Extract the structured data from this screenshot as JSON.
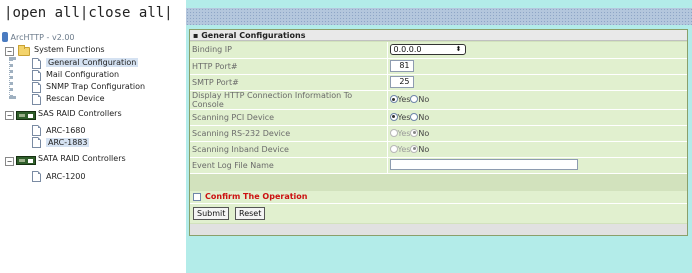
{
  "toolbar": {
    "open_all": "open all",
    "sep": "|",
    "close_all": "close all"
  },
  "tree": {
    "root": "ArcHTTP - v2.00",
    "system_functions": "System Functions",
    "items": [
      "General Configuration",
      "Mail Configuration",
      "SNMP Trap Configuration",
      "Rescan Device"
    ],
    "sas": "SAS RAID Controllers",
    "sas_items": [
      "ARC-1680",
      "ARC-1883"
    ],
    "sata": "SATA RAID Controllers",
    "sata_items": [
      "ARC-1200"
    ]
  },
  "panel": {
    "title": "General Configurations",
    "rows": [
      {
        "label": "Binding IP",
        "value": "0.0.0.0"
      },
      {
        "label": "HTTP Port#",
        "value": "81"
      },
      {
        "label": "SMTP Port#",
        "value": "25"
      },
      {
        "label": "Display HTTP Connection Information To Console",
        "yes": "Yes",
        "no": "No",
        "selected": "Yes"
      },
      {
        "label": "Scanning PCI Device",
        "yes": "Yes",
        "no": "No",
        "selected": "Yes"
      },
      {
        "label": "Scanning RS-232 Device",
        "yes": "Yes",
        "no": "No",
        "selected": "No"
      },
      {
        "label": "Scanning Inband Device",
        "yes": "Yes",
        "no": "No",
        "selected": "No"
      },
      {
        "label": "Event Log File Name",
        "value": ""
      }
    ],
    "confirm": "Confirm The Operation",
    "submit": "Submit",
    "reset": "Reset"
  },
  "colors": {
    "accent_bg": "#b3ece9",
    "panel": "#d2e2bd",
    "confirm_text": "#cc1111"
  }
}
